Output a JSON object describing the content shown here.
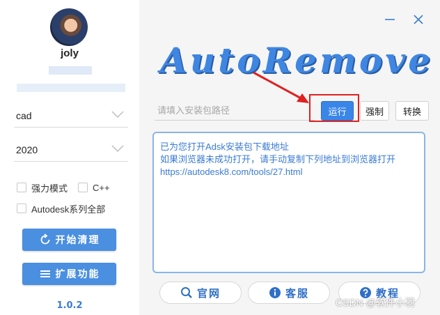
{
  "colors": {
    "accent": "#3a86e8",
    "highlight": "#e02020",
    "log_text": "#3a7bd5"
  },
  "sidebar": {
    "username": "joly",
    "product_select": "cad",
    "year_select": "2020",
    "options": [
      {
        "label": "强力模式",
        "checked": false
      },
      {
        "label": "C++",
        "checked": false
      },
      {
        "label": "Autodesk系列全部",
        "checked": false
      }
    ],
    "start_clean_label": "开始清理",
    "extend_label": "扩展功能",
    "version": "1.0.2"
  },
  "window": {
    "minimize_icon": "minimize-icon",
    "close_icon": "close-icon"
  },
  "logo_text": "AutoRemove",
  "path": {
    "placeholder": "请填入安装包路径",
    "value": ""
  },
  "actions": {
    "run_label": "运行",
    "force_label": "强制",
    "convert_label": "转换"
  },
  "log": {
    "lines": [
      "已为您打开Adsk安装包下载地址",
      "如果浏览器未成功打开，请手动复制下列地址到浏览器打开",
      "https://autodesk8.com/tools/27.html"
    ]
  },
  "footer": {
    "website_label": "官网",
    "support_label": "客服",
    "tutorial_label": "教程"
  },
  "watermark": "CSDN @软件小羽"
}
